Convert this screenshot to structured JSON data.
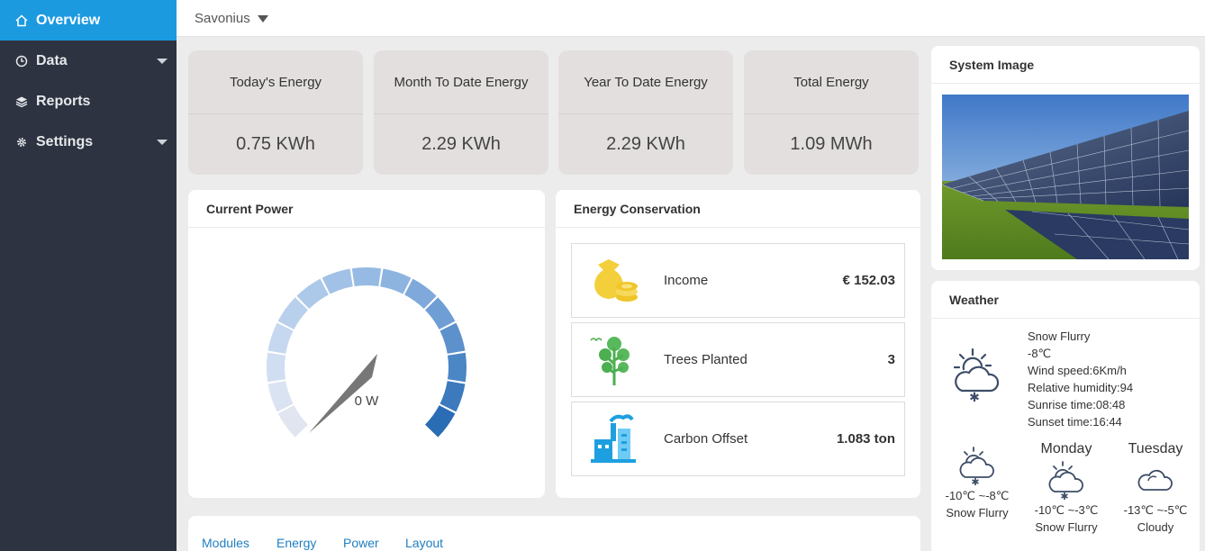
{
  "sidebar": {
    "items": [
      {
        "label": "Overview",
        "icon": "home-icon",
        "active": true,
        "has_caret": false
      },
      {
        "label": "Data",
        "icon": "clock-icon",
        "active": false,
        "has_caret": true
      },
      {
        "label": "Reports",
        "icon": "layers-icon",
        "active": false,
        "has_caret": false
      },
      {
        "label": "Settings",
        "icon": "gear-icon",
        "active": false,
        "has_caret": true
      }
    ]
  },
  "topbar": {
    "site": "Savonius"
  },
  "kpis": [
    {
      "title": "Today's Energy",
      "value": "0.75 KWh"
    },
    {
      "title": "Month To Date Energy",
      "value": "2.29 KWh"
    },
    {
      "title": "Year To Date Energy",
      "value": "2.29 KWh"
    },
    {
      "title": "Total Energy",
      "value": "1.09 MWh"
    }
  ],
  "current_power": {
    "title": "Current Power",
    "value_label": "0 W",
    "level": 0
  },
  "conservation": {
    "title": "Energy Conservation",
    "rows": [
      {
        "label": "Income",
        "value": "€ 152.03",
        "icon": "money-bag-icon"
      },
      {
        "label": "Trees Planted",
        "value": "3",
        "icon": "tree-icon"
      },
      {
        "label": "Carbon Offset",
        "value": "1.083 ton",
        "icon": "factory-icon"
      }
    ]
  },
  "system_image": {
    "title": "System Image"
  },
  "weather": {
    "title": "Weather",
    "current": {
      "condition": "Snow Flurry",
      "temp": "-8℃",
      "wind": "Wind speed:6Km/h",
      "humidity": "Relative humidity:94",
      "sunrise": "Sunrise time:08:48",
      "sunset": "Sunset time:16:44"
    },
    "forecast": [
      {
        "day": "",
        "range": "-10℃ ~-8℃",
        "condition": "Snow Flurry"
      },
      {
        "day": "Monday",
        "range": "-10℃ ~-3℃",
        "condition": "Snow Flurry"
      },
      {
        "day": "Tuesday",
        "range": "-13℃ ~-5℃",
        "condition": "Cloudy"
      }
    ]
  },
  "tabs": [
    "Modules",
    "Energy",
    "Power",
    "Layout"
  ],
  "colors": {
    "accent": "#1c9ae0",
    "sidebar": "#2d3340",
    "link": "#1e7fc1",
    "kpi_bg": "#e3dfdf"
  }
}
